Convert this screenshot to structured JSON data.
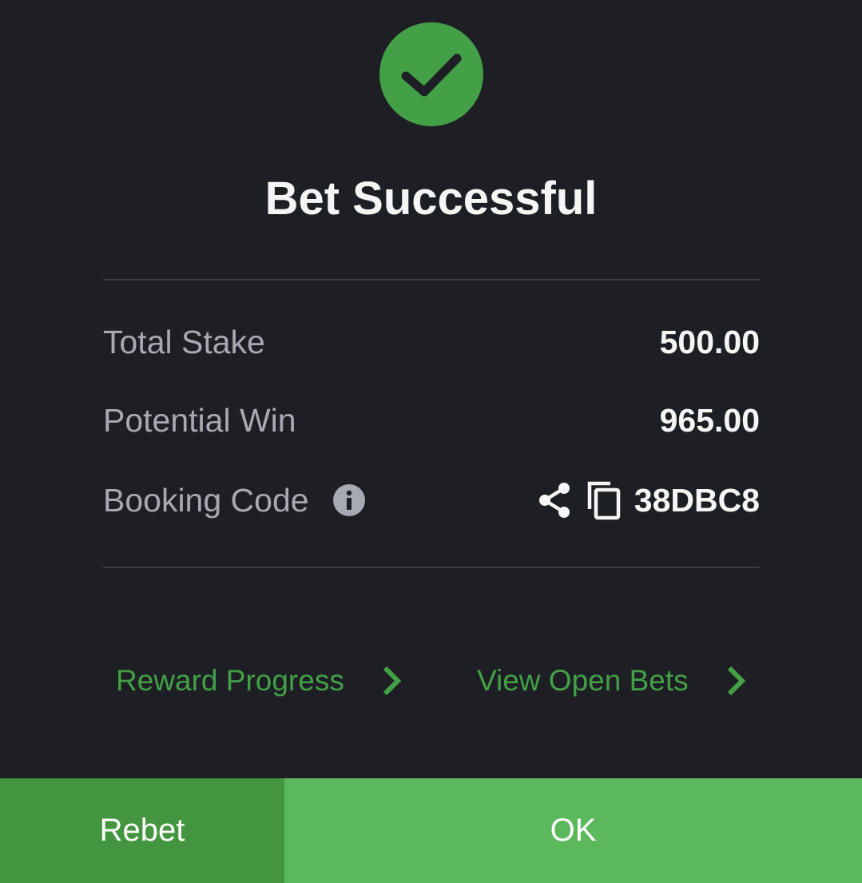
{
  "dialog": {
    "title": "Bet Successful",
    "status_icon": "check-icon",
    "accent_color": "#43a047"
  },
  "summary": {
    "total_stake_label": "Total Stake",
    "total_stake_value": "500.00",
    "potential_win_label": "Potential Win",
    "potential_win_value": "965.00",
    "booking_code_label": "Booking Code",
    "booking_code_value": "38DBC8",
    "icons": [
      "info-icon",
      "share-icon",
      "copy-icon"
    ]
  },
  "links": {
    "reward_progress": "Reward Progress",
    "view_open_bets": "View Open Bets"
  },
  "footer": {
    "rebet_label": "Rebet",
    "ok_label": "OK",
    "rebet_color": "#43963f",
    "ok_color": "#5cb85c"
  }
}
